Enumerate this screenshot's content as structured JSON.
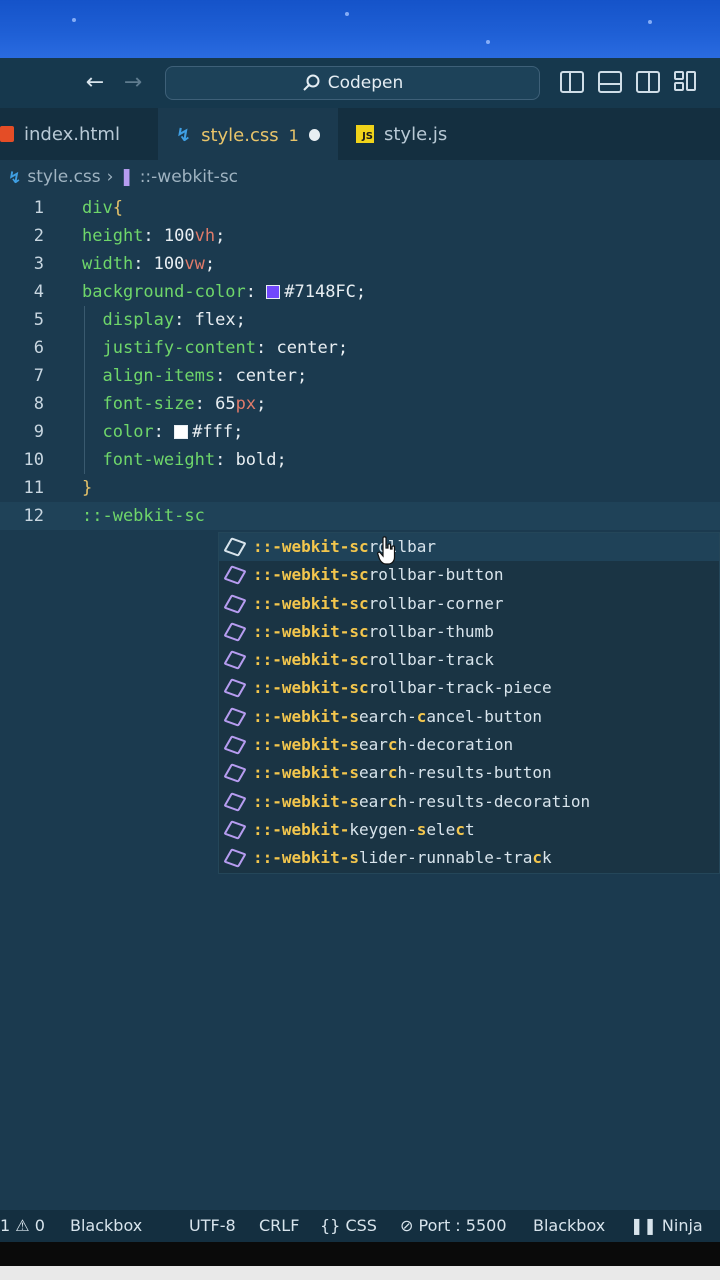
{
  "window": {
    "search_label": "Codepen"
  },
  "tabs": [
    {
      "label": "index.html"
    },
    {
      "label": "style.css",
      "badge": "1"
    },
    {
      "label": "style.js"
    }
  ],
  "breadcrumb": {
    "file": "style.css",
    "symbol": "::-webkit-sc"
  },
  "editor": {
    "line_numbers": [
      "1",
      "2",
      "3",
      "4",
      "5",
      "6",
      "7",
      "8",
      "9",
      "10",
      "11",
      "12"
    ],
    "lines": {
      "l1_sel": "div",
      "l1_brace": "{",
      "l2_prop": "height",
      "l2_num": "100",
      "l2_unit": "vh",
      "l3_prop": "width",
      "l3_num": "100",
      "l3_unit": "vw",
      "l4_prop": "background-color",
      "l4_val": "#7148FC",
      "l5_prop": "display",
      "l5_val": "flex",
      "l6_prop": "justify-content",
      "l6_val": "center",
      "l7_prop": "align-items",
      "l7_val": "center",
      "l8_prop": "font-size",
      "l8_num": "65",
      "l8_unit": "px",
      "l9_prop": "color",
      "l9_val": "#fff",
      "l10_prop": "font-weight",
      "l10_val": "bold",
      "l11_brace": "}",
      "l12_text": "::-webkit-sc"
    },
    "swatch_colors": {
      "bg": "#7148FC",
      "color": "#ffffff"
    }
  },
  "suggestions": [
    {
      "match": "::-webkit-sc",
      "rest": "rollbar"
    },
    {
      "match": "::-webkit-sc",
      "rest": "rollbar-button"
    },
    {
      "match": "::-webkit-sc",
      "rest": "rollbar-corner"
    },
    {
      "match": "::-webkit-sc",
      "rest": "rollbar-thumb"
    },
    {
      "match": "::-webkit-sc",
      "rest": "rollbar-track"
    },
    {
      "match": "::-webkit-sc",
      "rest": "rollbar-track-piece"
    },
    {
      "match": "::-webkit-s",
      "rest": "earch-",
      "m2": "c",
      "rest2": "ancel-button"
    },
    {
      "match": "::-webkit-s",
      "rest": "ear",
      "m2": "c",
      "rest2": "h-decoration"
    },
    {
      "match": "::-webkit-s",
      "rest": "ear",
      "m2": "c",
      "rest2": "h-results-button"
    },
    {
      "match": "::-webkit-s",
      "rest": "ear",
      "m2": "c",
      "rest2": "h-results-decoration"
    },
    {
      "match": "::-webkit-",
      "rest": "keygen-",
      "m2": "s",
      "rest2": "ele",
      "m3": "c",
      "rest3": "t"
    },
    {
      "match": "::-webkit-s",
      "rest": "lider-runnable-tra",
      "m2": "c",
      "rest2": "k"
    }
  ],
  "statusbar": {
    "problems": "1",
    "warnings": "0",
    "blackbox1": "Blackbox",
    "encoding": "UTF-8",
    "eol": "CRLF",
    "language": "CSS",
    "port": "Port : 5500",
    "blackbox2": "Blackbox",
    "ninja": "Ninja"
  },
  "icons": {
    "back": "arrow-left",
    "forward": "arrow-right",
    "search": "search",
    "layouts": [
      "toggle-sidebar",
      "toggle-panel",
      "toggle-secondary-sidebar",
      "customize-layout"
    ]
  }
}
